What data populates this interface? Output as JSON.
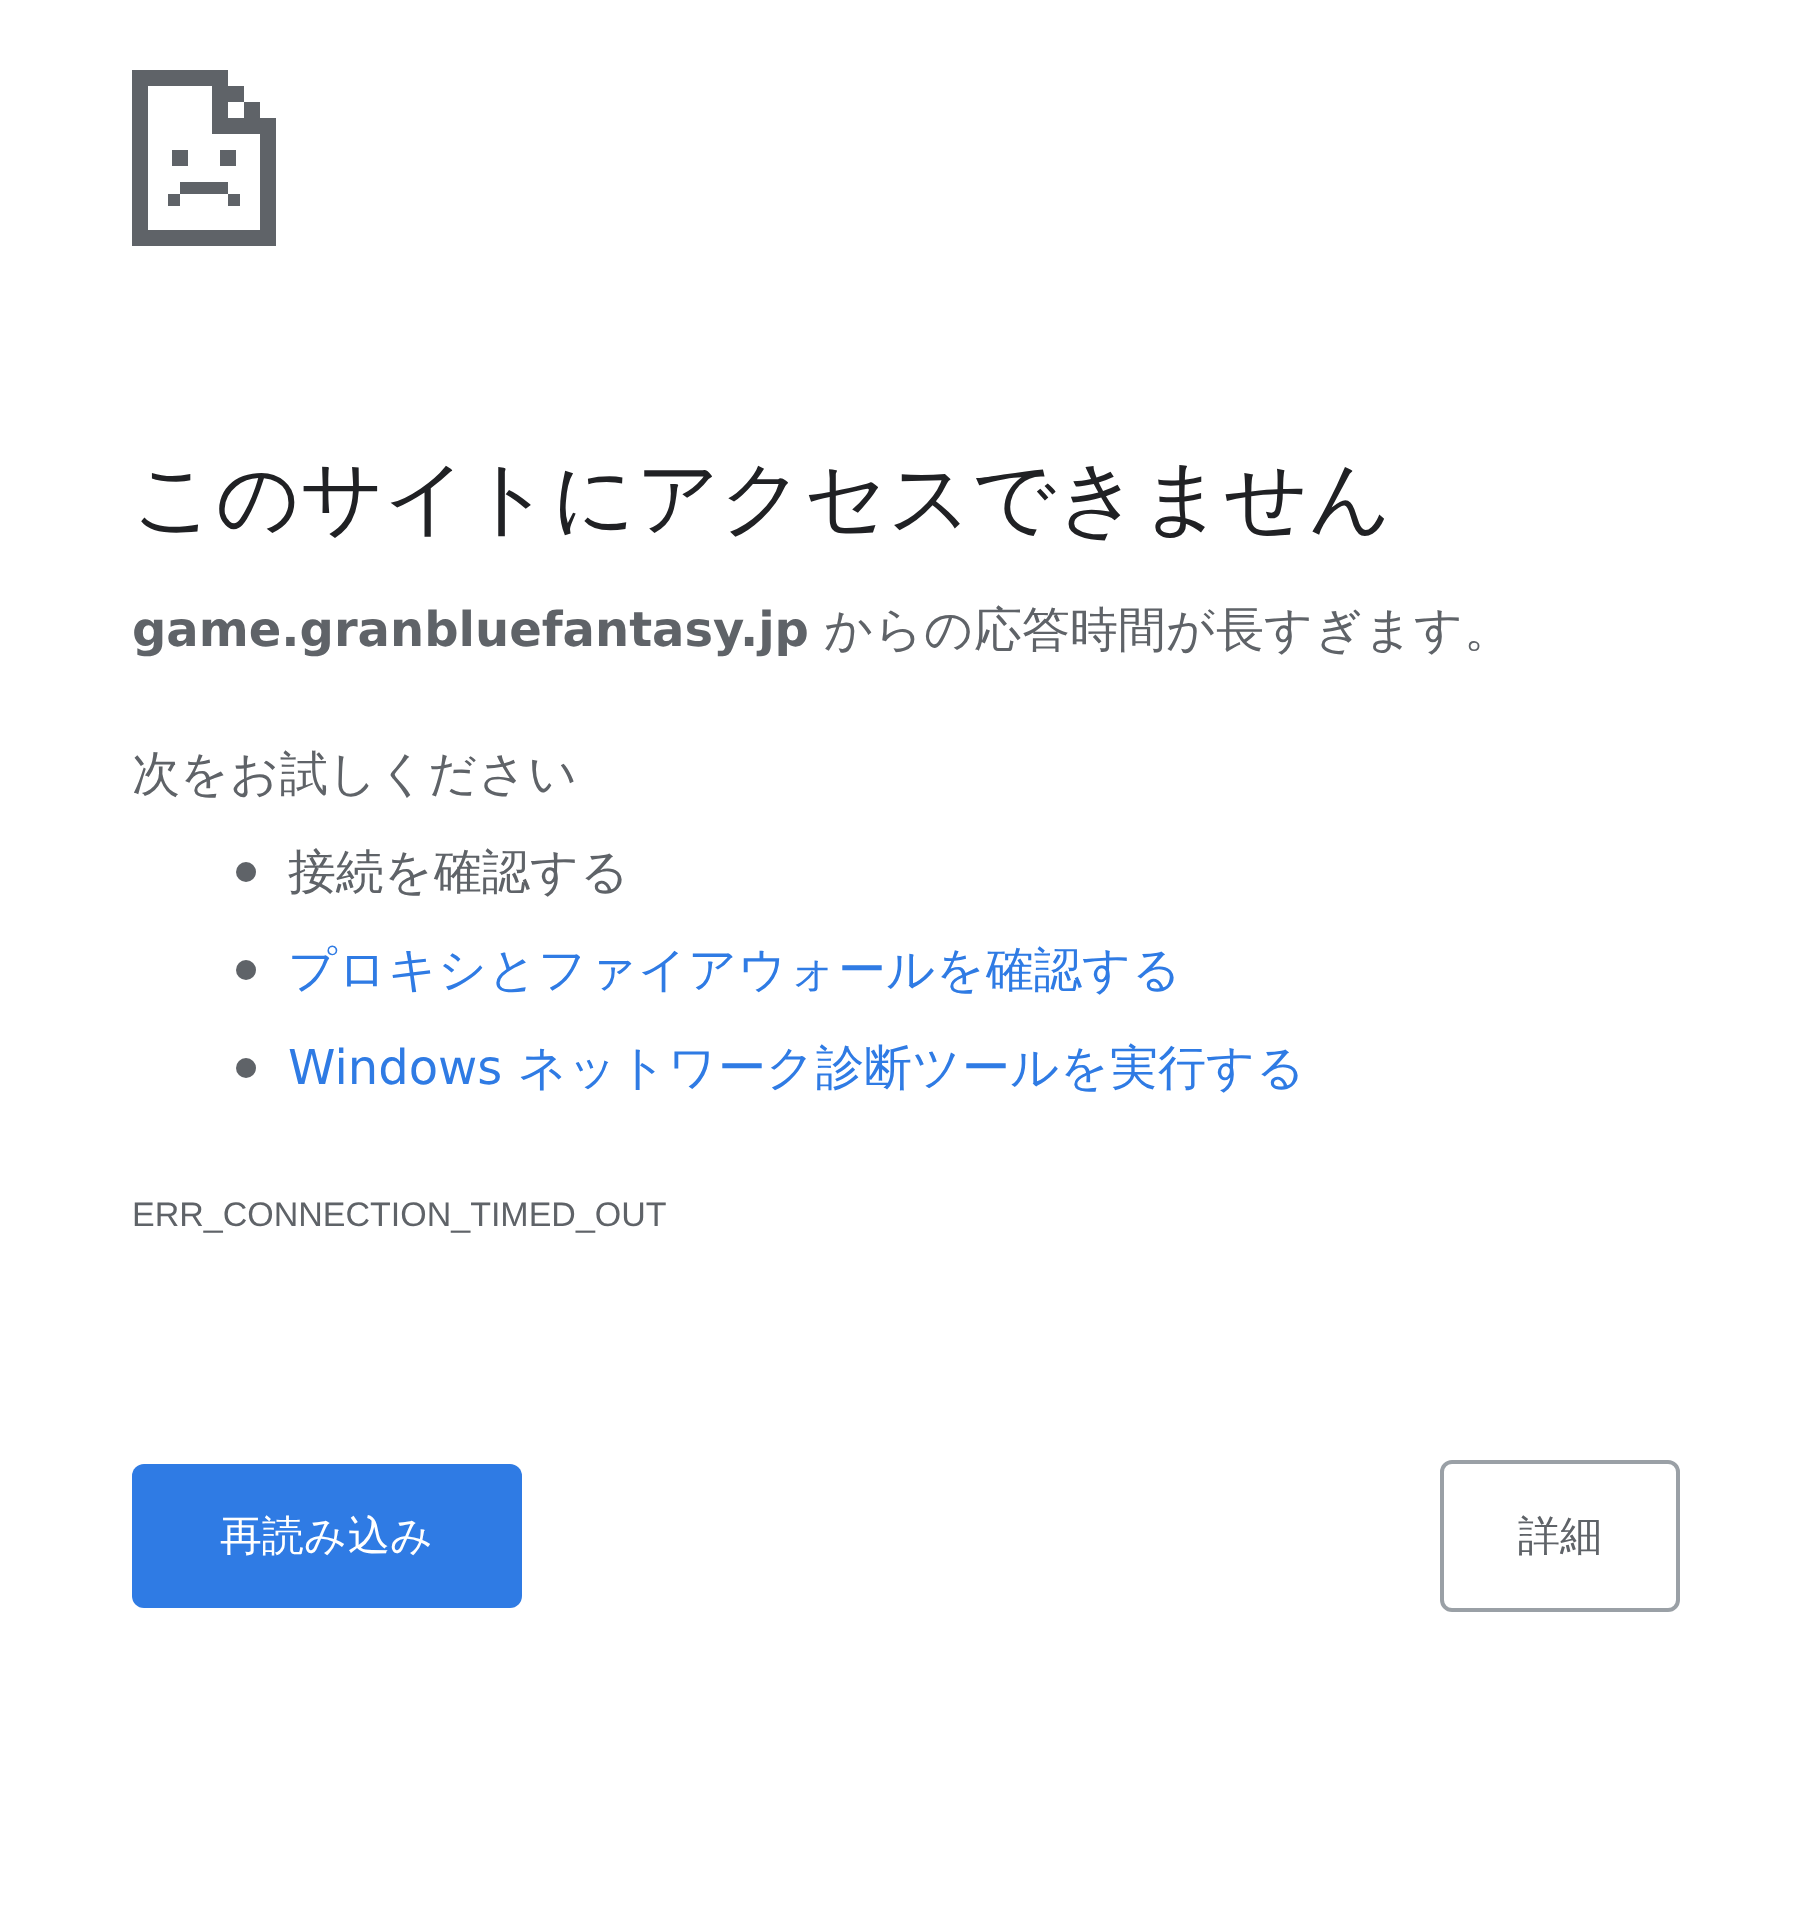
{
  "title": "このサイトにアクセスできません",
  "message": "**game.granbluefantasy.jp** からの応答時間が長すぎます。",
  "suggestions_heading": "次をお試しください",
  "suggestions": [
    {
      "kind": "text",
      "label": "接続を確認する"
    },
    {
      "kind": "link",
      "label": "プロキシとファイアウォールを確認する"
    },
    {
      "kind": "link",
      "label": "Windows ネットワーク診断ツールを実行する"
    }
  ],
  "error_code": "ERR_CONNECTION_TIMED_OUT",
  "buttons": [
    {
      "kind": "primary",
      "label": "再読み込み"
    },
    {
      "kind": "secondary",
      "label": "詳細"
    }
  ]
}
